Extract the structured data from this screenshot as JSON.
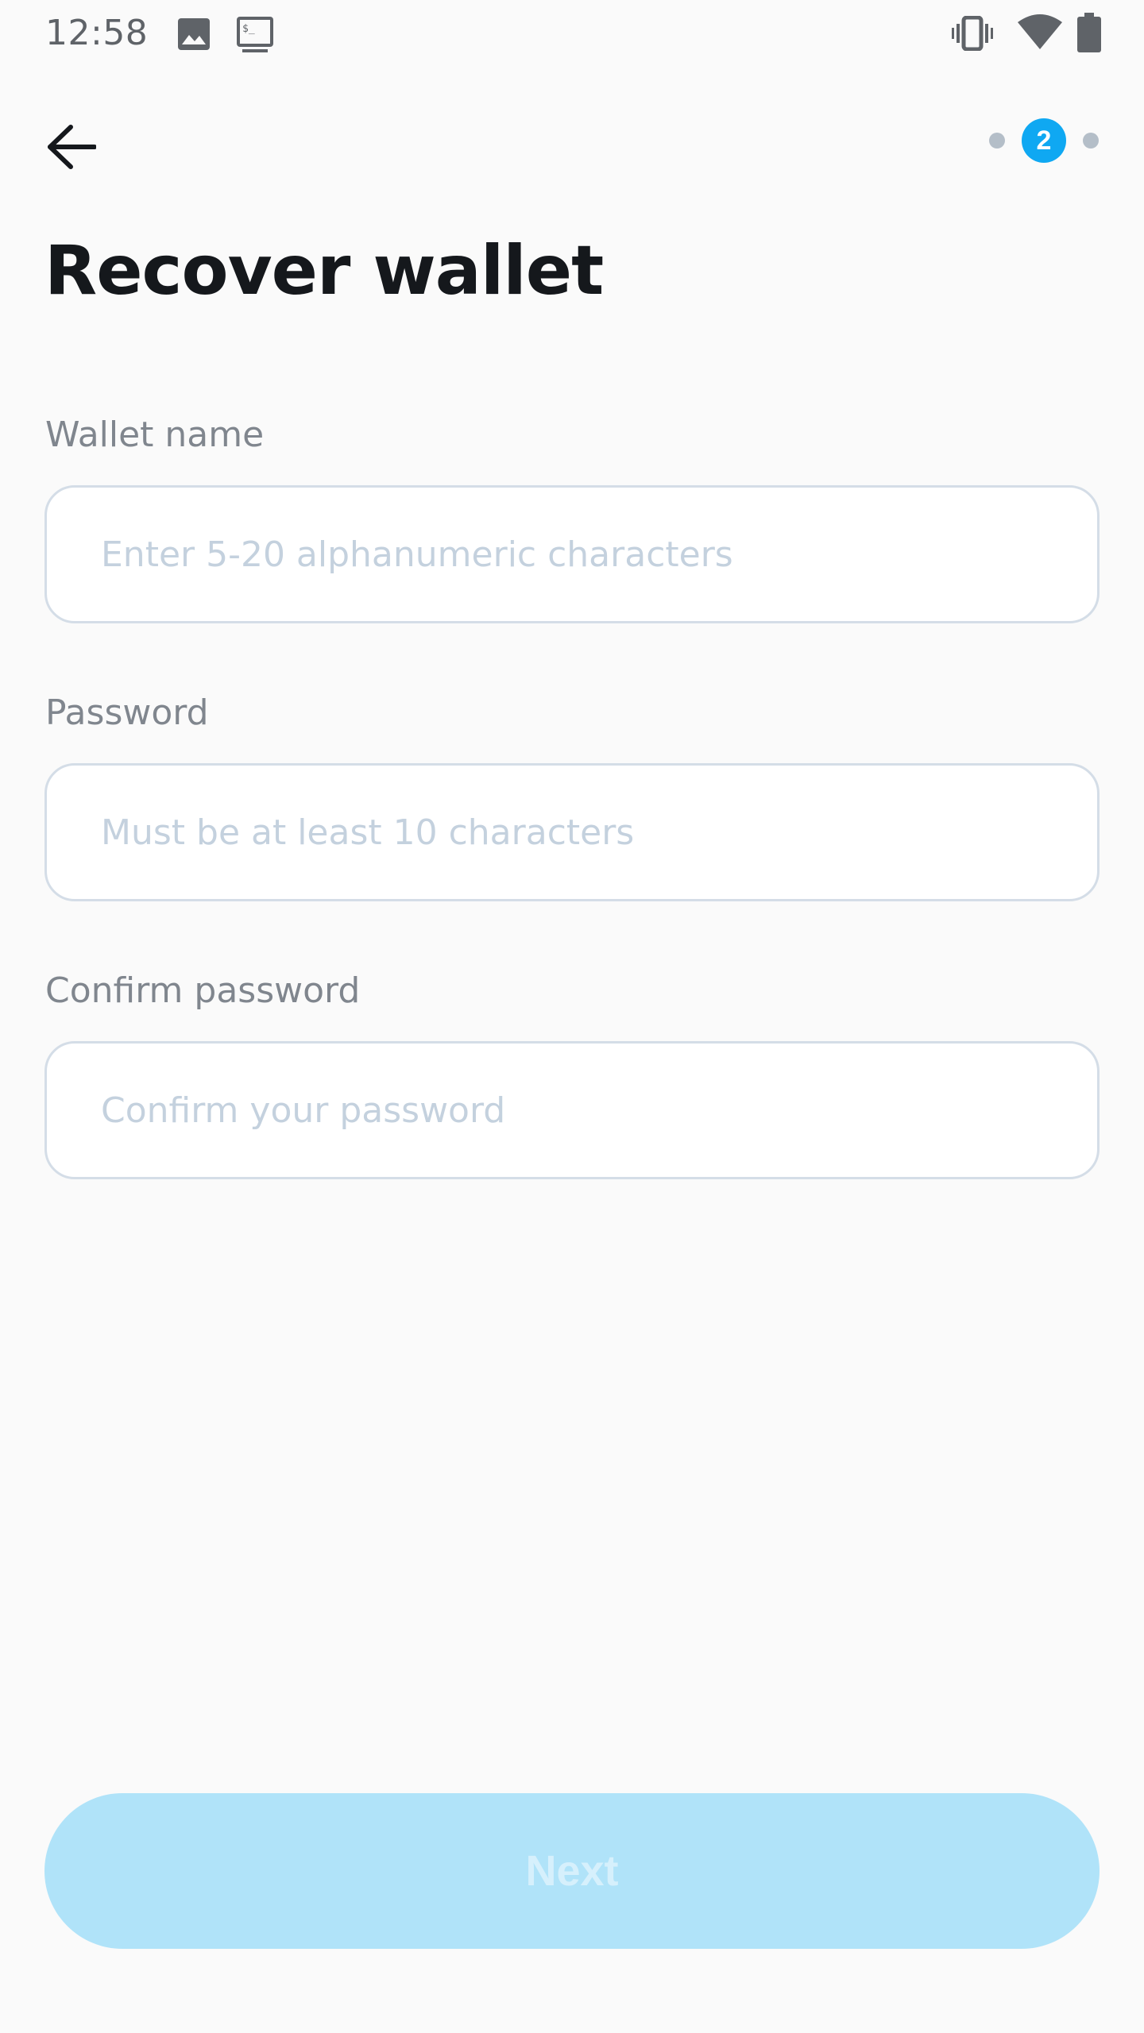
{
  "status_bar": {
    "time": "12:58",
    "left_icons": [
      "image-icon",
      "terminal-icon"
    ],
    "right_icons": [
      "vibrate-icon",
      "wifi-icon",
      "battery-icon"
    ]
  },
  "nav": {
    "back_icon": "arrow-left-icon",
    "stepper": {
      "current_step": "2",
      "steps": 3,
      "accent_color": "#0fa8f2"
    }
  },
  "page": {
    "title": "Recover wallet"
  },
  "form": {
    "wallet_name": {
      "label": "Wallet name",
      "placeholder": "Enter 5-20 alphanumeric characters",
      "value": ""
    },
    "password": {
      "label": "Password",
      "placeholder": "Must be at least 10 characters",
      "value": ""
    },
    "confirm_password": {
      "label": "Confirm password",
      "placeholder": "Confirm your password",
      "value": ""
    }
  },
  "actions": {
    "next_label": "Next",
    "next_disabled": true
  }
}
